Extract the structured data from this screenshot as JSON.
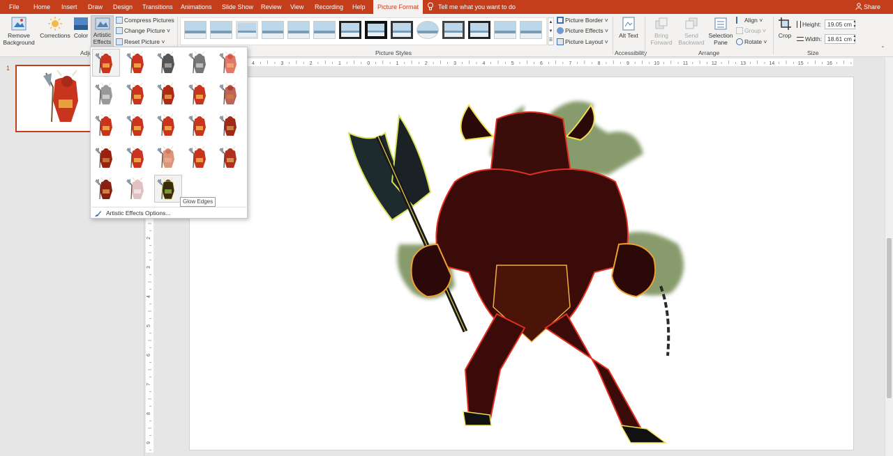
{
  "tabs": [
    {
      "label": "File"
    },
    {
      "label": "Home"
    },
    {
      "label": "Insert"
    },
    {
      "label": "Draw"
    },
    {
      "label": "Design"
    },
    {
      "label": "Transitions"
    },
    {
      "label": "Animations"
    },
    {
      "label": "Slide Show"
    },
    {
      "label": "Review"
    },
    {
      "label": "View"
    },
    {
      "label": "Recording"
    },
    {
      "label": "Help"
    },
    {
      "label": "Picture Format"
    }
  ],
  "tell_me": "Tell me what you want to do",
  "share": "Share",
  "ribbon": {
    "remove_background": "Remove Background",
    "corrections": "Corrections",
    "color": "Color",
    "artistic_effects": "Artistic Effects",
    "compress_pictures": "Compress Pictures",
    "change_picture": "Change Picture",
    "reset_picture": "Reset Picture",
    "adjust_group": "Adju",
    "picture_styles_group": "Picture Styles",
    "picture_border": "Picture Border",
    "picture_effects": "Picture Effects",
    "picture_layout": "Picture Layout",
    "alt_text": "Alt Text",
    "accessibility_group": "Accessibility",
    "bring_forward": "Bring Forward",
    "send_backward": "Send Backward",
    "selection_pane": "Selection Pane",
    "align": "Align",
    "group": "Group",
    "rotate": "Rotate",
    "arrange_group": "Arrange",
    "crop": "Crop",
    "height_label": "Height:",
    "height_value": "19.05 cm",
    "width_label": "Width:",
    "width_value": "18.61 cm",
    "size_group": "Size"
  },
  "slide_number": "1",
  "artistic_menu": {
    "tooltip": "Glow Edges",
    "options_label": "Artistic Effects Options..."
  },
  "hruler_ticks": [
    "4",
    "3",
    "2",
    "1",
    "0",
    "1",
    "2",
    "3",
    "4",
    "5",
    "6",
    "7",
    "8",
    "9",
    "10",
    "11",
    "12",
    "13",
    "14",
    "15",
    "16"
  ],
  "vruler_ticks": [
    "1",
    "2",
    "3",
    "4",
    "5",
    "6",
    "7",
    "8",
    "9"
  ],
  "colors": {
    "accent": "#c43e1c",
    "ribbon_bg": "#f3f2f1",
    "canvas_bg": "#e6e6e6"
  }
}
